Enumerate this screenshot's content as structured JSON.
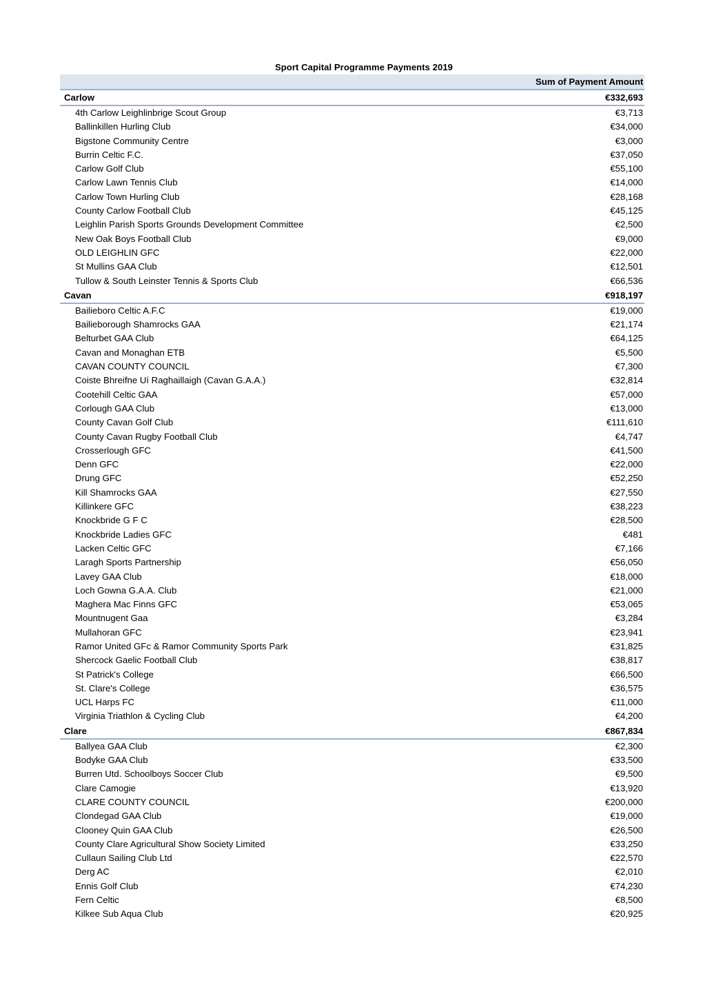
{
  "document": {
    "title": "Sport Capital Programme Payments 2019",
    "value_column_header": "Sum of Payment Amount",
    "label_column_header": "",
    "accent_header_bg": "#DCE6F1",
    "accent_rule_color": "#95B3D7"
  },
  "table": {
    "columns": [
      "",
      "Sum of Payment Amount"
    ],
    "groups": [
      {
        "name": "Carlow",
        "total": "€332,693",
        "rows": [
          {
            "label": "4th Carlow Leighlinbrige Scout Group",
            "value": "€3,713"
          },
          {
            "label": "Ballinkillen Hurling Club",
            "value": "€34,000"
          },
          {
            "label": "Bigstone Community Centre",
            "value": "€3,000"
          },
          {
            "label": "Burrin Celtic F.C.",
            "value": "€37,050"
          },
          {
            "label": "Carlow Golf Club",
            "value": "€55,100"
          },
          {
            "label": "Carlow Lawn Tennis Club",
            "value": "€14,000"
          },
          {
            "label": "Carlow Town Hurling Club",
            "value": "€28,168"
          },
          {
            "label": "County Carlow Football Club",
            "value": "€45,125"
          },
          {
            "label": "Leighlin Parish Sports Grounds Development Committee",
            "value": "€2,500"
          },
          {
            "label": "New Oak Boys Football Club",
            "value": "€9,000"
          },
          {
            "label": "OLD LEIGHLIN GFC",
            "value": "€22,000"
          },
          {
            "label": "St Mullins GAA Club",
            "value": "€12,501"
          },
          {
            "label": "Tullow & South Leinster Tennis & Sports Club",
            "value": "€66,536"
          }
        ]
      },
      {
        "name": "Cavan",
        "total": "€918,197",
        "rows": [
          {
            "label": "Bailieboro Celtic A.F.C",
            "value": "€19,000"
          },
          {
            "label": "Bailieborough Shamrocks GAA",
            "value": "€21,174"
          },
          {
            "label": "Belturbet GAA Club",
            "value": "€64,125"
          },
          {
            "label": "Cavan and Monaghan ETB",
            "value": "€5,500"
          },
          {
            "label": "CAVAN COUNTY COUNCIL",
            "value": "€7,300"
          },
          {
            "label": "Coiste Bhreifne Uí Raghaillaigh (Cavan G.A.A.)",
            "value": "€32,814"
          },
          {
            "label": "Cootehill Celtic GAA",
            "value": "€57,000"
          },
          {
            "label": "Corlough GAA Club",
            "value": "€13,000"
          },
          {
            "label": "County Cavan Golf Club",
            "value": "€111,610"
          },
          {
            "label": "County Cavan Rugby Football Club",
            "value": "€4,747"
          },
          {
            "label": "Crosserlough GFC",
            "value": "€41,500"
          },
          {
            "label": "Denn GFC",
            "value": "€22,000"
          },
          {
            "label": "Drung GFC",
            "value": "€52,250"
          },
          {
            "label": "Kill Shamrocks GAA",
            "value": "€27,550"
          },
          {
            "label": "Killinkere GFC",
            "value": "€38,223"
          },
          {
            "label": "Knockbride G F C",
            "value": "€28,500"
          },
          {
            "label": "Knockbride Ladies GFC",
            "value": "€481"
          },
          {
            "label": "Lacken Celtic GFC",
            "value": "€7,166"
          },
          {
            "label": "Laragh Sports Partnership",
            "value": "€56,050"
          },
          {
            "label": "Lavey GAA Club",
            "value": "€18,000"
          },
          {
            "label": "Loch Gowna G.A.A. Club",
            "value": "€21,000"
          },
          {
            "label": "Maghera Mac Finns GFC",
            "value": "€53,065"
          },
          {
            "label": "Mountnugent Gaa",
            "value": "€3,284"
          },
          {
            "label": "Mullahoran GFC",
            "value": "€23,941"
          },
          {
            "label": "Ramor United GFc & Ramor Community Sports Park",
            "value": "€31,825"
          },
          {
            "label": "Shercock Gaelic Football Club",
            "value": "€38,817"
          },
          {
            "label": "St Patrick's College",
            "value": "€66,500"
          },
          {
            "label": "St. Clare's College",
            "value": "€36,575"
          },
          {
            "label": "UCL Harps FC",
            "value": "€11,000"
          },
          {
            "label": "Virginia Triathlon & Cycling Club",
            "value": "€4,200"
          }
        ]
      },
      {
        "name": "Clare",
        "total": "€867,834",
        "rows": [
          {
            "label": "Ballyea GAA Club",
            "value": "€2,300"
          },
          {
            "label": "Bodyke GAA Club",
            "value": "€33,500"
          },
          {
            "label": "Burren Utd. Schoolboys Soccer Club",
            "value": "€9,500"
          },
          {
            "label": "Clare Camogie",
            "value": "€13,920"
          },
          {
            "label": "CLARE COUNTY COUNCIL",
            "value": "€200,000"
          },
          {
            "label": "Clondegad GAA Club",
            "value": "€19,000"
          },
          {
            "label": "Clooney Quin GAA Club",
            "value": "€26,500"
          },
          {
            "label": "County Clare Agricultural Show Society Limited",
            "value": "€33,250"
          },
          {
            "label": "Cullaun Sailing Club Ltd",
            "value": "€22,570"
          },
          {
            "label": "Derg AC",
            "value": "€2,010"
          },
          {
            "label": "Ennis Golf Club",
            "value": "€74,230"
          },
          {
            "label": "Fern Celtic",
            "value": "€8,500"
          },
          {
            "label": "Kilkee Sub Aqua Club",
            "value": "€20,925"
          }
        ]
      }
    ]
  }
}
